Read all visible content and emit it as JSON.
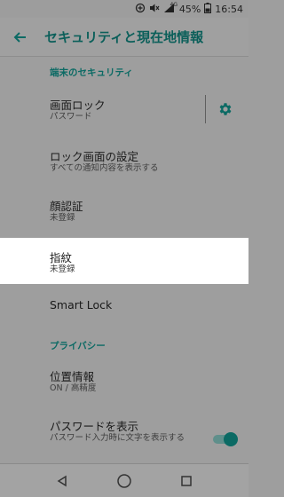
{
  "status_bar": {
    "battery_percent": "45%",
    "time": "16:54",
    "icons": [
      "data-saver-icon",
      "mute-icon",
      "lte-signal-icon",
      "battery-icon"
    ],
    "network_label": "4G"
  },
  "app_bar": {
    "title": "セキュリティと現在地情報",
    "back_icon": "arrow-back-icon"
  },
  "sections": {
    "device_security": "端末のセキュリティ",
    "privacy": "プライバシー"
  },
  "items": {
    "screen_lock": {
      "title": "画面ロック",
      "summary": "パスワード"
    },
    "lock_screen_settings": {
      "title": "ロック画面の設定",
      "summary": "すべての通知内容を表示する"
    },
    "face_auth": {
      "title": "顔認証",
      "summary": "未登録"
    },
    "fingerprint": {
      "title": "指紋",
      "summary": "未登録"
    },
    "smart_lock": {
      "title": "Smart Lock"
    },
    "location": {
      "title": "位置情報",
      "summary": "ON / 高精度"
    },
    "show_password": {
      "title": "パスワードを表示",
      "summary": "パスワード入力時に文字を表示する",
      "enabled": true
    }
  },
  "colors": {
    "accent": "#0b6a64",
    "scrim_background": "#9e9e9e",
    "highlight": "#ffffff"
  },
  "nav_bar": {
    "back_icon": "nav-back-icon",
    "home_icon": "nav-home-icon",
    "recents_icon": "nav-recents-icon"
  }
}
